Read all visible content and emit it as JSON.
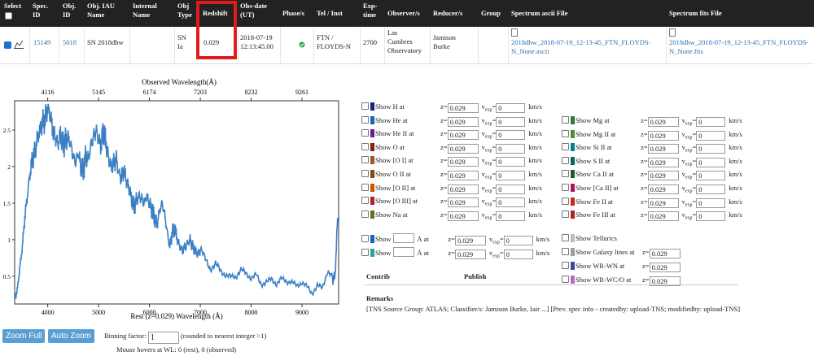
{
  "table": {
    "headers": {
      "select": "Select",
      "spec_id": [
        "Spec.",
        "ID"
      ],
      "obj_id": [
        "Obj.",
        "ID"
      ],
      "iau_name": [
        "Obj. IAU",
        "Name"
      ],
      "internal_name": [
        "Internal",
        "Name"
      ],
      "obj_type": [
        "Obj",
        "Type"
      ],
      "redshift": "Redshift",
      "obs_date": [
        "Obs-date",
        "(UT)"
      ],
      "phase": "Phase/s",
      "tel_inst": "Tel / Inst",
      "exp_time": [
        "Exp-",
        "time"
      ],
      "observers": "Observer/s",
      "reducers": "Reducer/s",
      "group": "Group",
      "ascii": "Spectrum ascii File",
      "fits": "Spectrum fits File"
    },
    "row": {
      "spec_id": "15149",
      "obj_id": "5018",
      "iau_name": "SN 2018dhw",
      "internal_name": "",
      "obj_type": [
        "SN",
        "Ia"
      ],
      "redshift": "0.029",
      "obs_date": [
        "2018-07-19",
        "12:13:45.00"
      ],
      "phase_icon": "check-circle-icon",
      "tel_inst": [
        "FTN /",
        "FLOYDS-N"
      ],
      "exp_time": "2700",
      "observers": [
        "Las",
        "Cumbres",
        "Observatory"
      ],
      "reducers": [
        "Jamison",
        "Burke"
      ],
      "group": "",
      "ascii_file": [
        "2018dhw_2018-07-19_12-13-45_FTN_FLOYDS-",
        "N_None.ascii"
      ],
      "fits_file": [
        "2018dhw_2018-07-19_12-13-45_FTN_FLOYDS-",
        "N_None.fits"
      ]
    },
    "highlight_color": "#e01b1b"
  },
  "chart_data": {
    "type": "line",
    "title": "Observed Wavelength(Å)",
    "xlabel": "Rest (z=0.029) Wavelength (Å)",
    "ylabel": "",
    "x_ticks": [
      4000,
      5000,
      6000,
      7000,
      8000,
      9000
    ],
    "top_ticks": [
      4116,
      5145,
      6174,
      7203,
      8232,
      9261
    ],
    "y_ticks": [
      0.5,
      1.0,
      1.5,
      2.0,
      2.5
    ],
    "xlim": [
      3350,
      9720
    ],
    "ylim": [
      0.12,
      2.9
    ],
    "series_color": "#3a7fc4",
    "series": [
      {
        "x": [
          3350,
          3400,
          3450,
          3500,
          3550,
          3600,
          3650,
          3700,
          3750,
          3800,
          3850,
          3900,
          3950,
          4000,
          4050,
          4100,
          4150,
          4200,
          4250,
          4300,
          4350,
          4400,
          4450,
          4500,
          4550,
          4600,
          4650,
          4700,
          4750,
          4800,
          4850,
          4900,
          4950,
          5000,
          5050,
          5100,
          5150,
          5200,
          5250,
          5300,
          5350,
          5400,
          5450,
          5500,
          5550,
          5600,
          5650,
          5700,
          5750,
          5800,
          5850,
          5900,
          5950,
          6000,
          6050,
          6100,
          6150,
          6200,
          6250,
          6300,
          6350,
          6400,
          6450,
          6500,
          6550,
          6600,
          6650,
          6700,
          6750,
          6800,
          6850,
          6900,
          6950,
          7000,
          7100,
          7200,
          7300,
          7400,
          7500,
          7600,
          7700,
          7800,
          7900,
          8000,
          8100,
          8200,
          8300,
          8400,
          8500,
          8600,
          8700,
          8800,
          8900,
          9000,
          9100,
          9200,
          9300,
          9400,
          9500,
          9600,
          9650,
          9700
        ],
        "values": [
          0.2,
          0.3,
          0.6,
          0.9,
          1.3,
          1.6,
          1.9,
          2.1,
          2.2,
          2.4,
          2.5,
          2.6,
          2.65,
          2.8,
          2.7,
          2.5,
          2.4,
          2.3,
          2.45,
          2.3,
          2.35,
          2.4,
          2.3,
          2.15,
          2.05,
          2.2,
          2.0,
          1.95,
          2.15,
          2.1,
          2.3,
          2.4,
          2.5,
          2.35,
          2.3,
          2.5,
          2.3,
          2.1,
          2.0,
          2.05,
          2.1,
          1.9,
          1.85,
          1.95,
          1.8,
          1.7,
          1.55,
          1.45,
          1.55,
          1.6,
          1.55,
          1.5,
          1.6,
          1.5,
          1.4,
          1.3,
          1.2,
          1.4,
          1.5,
          1.35,
          1.1,
          0.9,
          1.1,
          1.15,
          1.0,
          0.9,
          0.85,
          0.9,
          0.95,
          1.0,
          0.9,
          0.85,
          0.8,
          0.85,
          0.7,
          0.6,
          0.7,
          0.62,
          0.55,
          0.5,
          0.48,
          0.55,
          0.5,
          0.45,
          0.52,
          0.42,
          0.45,
          0.5,
          0.4,
          0.45,
          0.4,
          0.38,
          0.35,
          0.42,
          0.38,
          0.3,
          0.4,
          0.35,
          0.55,
          0.45,
          0.5,
          1.3
        ]
      }
    ]
  },
  "controls": {
    "zoom_full": "Zoom Full",
    "auto_zoom": "Auto Zoom",
    "binning_label": "Binning factor:",
    "binning_value": "1",
    "binning_note": "(rounded to nearest integer >1)",
    "mouse_hover": "Mouse hovers at WL: 0 (rest), 0 (observed)"
  },
  "lines_left": [
    {
      "label": "Show H at",
      "color": "#1a237e",
      "z": "0.029",
      "v": "0"
    },
    {
      "label": "Show He at",
      "color": "#1565c0",
      "z": "0.029",
      "v": "0"
    },
    {
      "label": "Show He II at",
      "color": "#6a1b9a",
      "z": "0.029",
      "v": "0"
    },
    {
      "label": "Show O at",
      "color": "#8b1a1a",
      "z": "0.029",
      "v": "0"
    },
    {
      "label": "Show [O I] at",
      "color": "#a0522d",
      "z": "0.029",
      "v": "0"
    },
    {
      "label": "Show O II at",
      "color": "#8b4513",
      "z": "0.029",
      "v": "0"
    },
    {
      "label": "Show [O II] at",
      "color": "#cc5500",
      "z": "0.029",
      "v": "0"
    },
    {
      "label": "Show [O III] at",
      "color": "#b22222",
      "z": "0.029",
      "v": "0"
    },
    {
      "label": "Show Na at",
      "color": "#6b6b1a",
      "z": "0.029",
      "v": "0"
    }
  ],
  "lines_right": [
    {
      "label": "Show Mg at",
      "color": "#2e7d32",
      "z": "0.029",
      "v": "0"
    },
    {
      "label": "Show Mg II at",
      "color": "#558b2f",
      "z": "0.029",
      "v": "0"
    },
    {
      "label": "Show Si II at",
      "color": "#00838f",
      "z": "0.029",
      "v": "0"
    },
    {
      "label": "Show S II at",
      "color": "#00695c",
      "z": "0.029",
      "v": "0"
    },
    {
      "label": "Show Ca II at",
      "color": "#1b5e20",
      "z": "0.029",
      "v": "0"
    },
    {
      "label": "Show [Ca II] at",
      "color": "#ad1457",
      "z": "0.029",
      "v": "0"
    },
    {
      "label": "Show Fe II at",
      "color": "#c62828",
      "z": "0.029",
      "v": "0"
    },
    {
      "label": "Show Fe III at",
      "color": "#b71c1c",
      "z": "0.029",
      "v": "0"
    }
  ],
  "custom_lines": [
    {
      "prefix": "Show",
      "unit": "Å at",
      "color": "#1565c0",
      "z": "0.029",
      "v": "0"
    },
    {
      "prefix": "Show",
      "unit": "Å at",
      "color": "#26a69a",
      "z": "0.029",
      "v": "0"
    }
  ],
  "extra_right": [
    {
      "label": "Show Tellurics",
      "color": "#bdbdbd"
    },
    {
      "label": "Show Galaxy lines at",
      "color": "#9e9e9e",
      "z": "0.029"
    },
    {
      "label": "Show WR-WN at",
      "color": "#3949ab",
      "z": "0.029"
    },
    {
      "label": "Show WR-WC/O at",
      "color": "#ba68c8",
      "z": "0.029"
    }
  ],
  "labels": {
    "z_prefix": "z=",
    "v_prefix": "v",
    "v_sub": "exp",
    "v_eq": "=",
    "kms": "km/s",
    "contrib": "Contrib",
    "publish": "Publish",
    "remarks_title": "Remarks",
    "remarks_text": "[TNS Source Group: ATLAS; Classifier/s: Jamison Burke, Iair ...] [Prev. spec info - createdby: upload-TNS; modifiedby: upload-TNS]"
  }
}
